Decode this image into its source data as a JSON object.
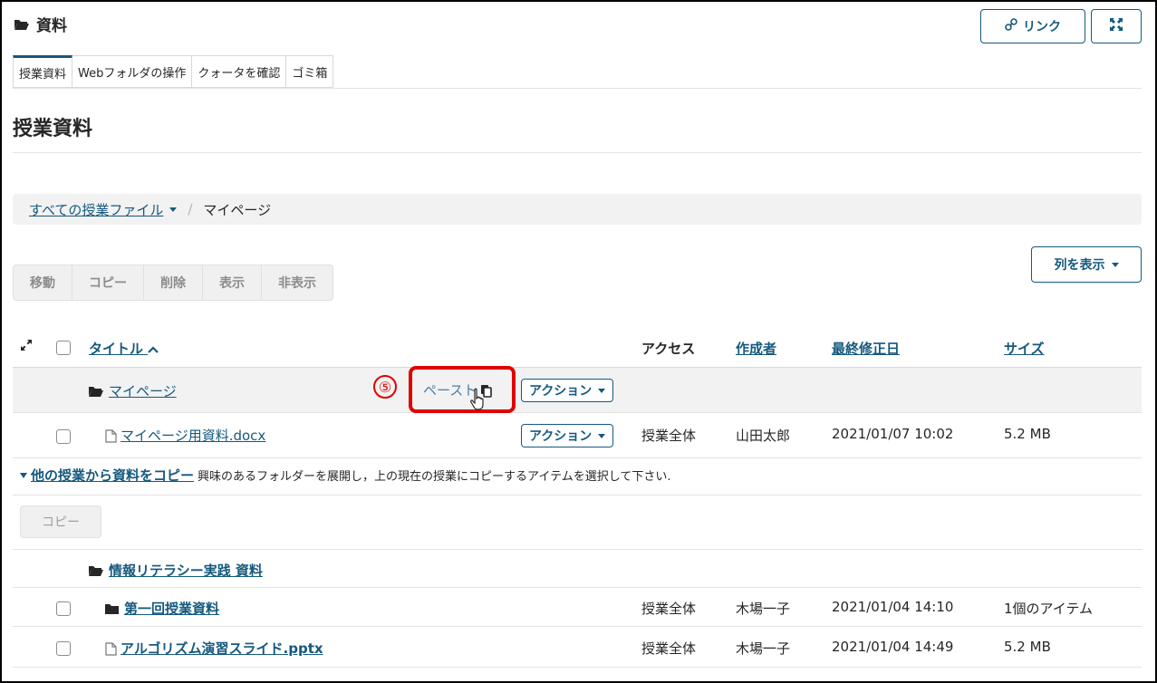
{
  "header": {
    "title": "資料",
    "link_button": "リンク"
  },
  "tabs": [
    {
      "label": "授業資料"
    },
    {
      "label": "Webフォルダの操作"
    },
    {
      "label": "クォータを確認"
    },
    {
      "label": "ゴミ箱"
    }
  ],
  "page_title": "授業資料",
  "breadcrumb": {
    "root": "すべての授業ファイル",
    "separator": "/",
    "current": "マイページ"
  },
  "actions": [
    "移動",
    "コピー",
    "削除",
    "表示",
    "非表示"
  ],
  "show_columns": "列を表示",
  "table": {
    "headers": {
      "title": "タイトル",
      "access": "アクセス",
      "creator": "作成者",
      "modified": "最終修正日",
      "size": "サイズ"
    },
    "folder_row": {
      "name": "マイページ",
      "paste_label": "ペースト",
      "action_label": "アクション"
    },
    "file_row": {
      "name": "マイページ用資料.docx",
      "action_label": "アクション",
      "access": "授業全体",
      "creator": "山田太郎",
      "modified": "2021/01/07 10:02",
      "size": "5.2 MB"
    }
  },
  "annotation_number": "⑤",
  "copy_section": {
    "link_label": "他の授業から資料をコピー",
    "description": "興味のあるフォルダーを展開し，上の現在の授業にコピーするアイテムを選択して下さい.",
    "copy_button": "コピー",
    "folder": "情報リテラシー実践 資料",
    "rows": [
      {
        "name": "第一回授業資料",
        "access": "授業全体",
        "creator": "木場一子",
        "modified": "2021/01/04 14:10",
        "size": "1個のアイテム"
      },
      {
        "name": "アルゴリズム演習スライド.pptx",
        "access": "授業全体",
        "creator": "木場一子",
        "modified": "2021/01/04 14:49",
        "size": "5.2 MB"
      }
    ]
  },
  "colors": {
    "accent": "#15597e",
    "highlight": "#e00000"
  }
}
